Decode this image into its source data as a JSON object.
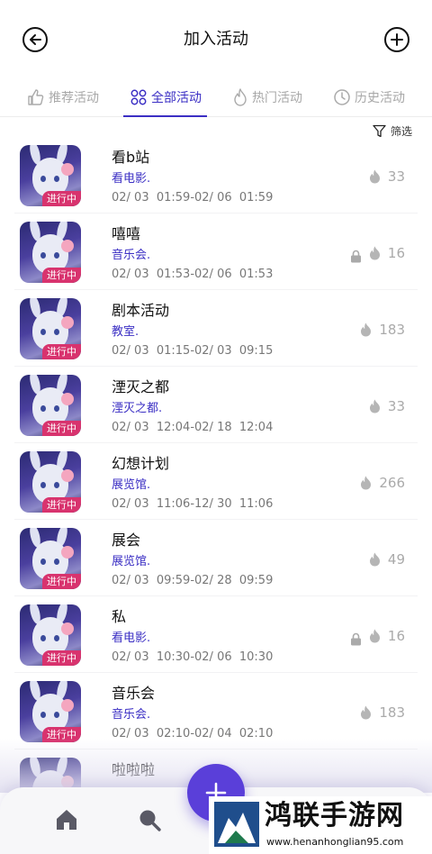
{
  "header": {
    "title": "加入活动",
    "back_icon": "arrow-left-icon",
    "add_icon": "plus-circle-icon"
  },
  "tabs": [
    {
      "label": "推荐活动",
      "icon": "thumbs-up-icon",
      "active": false
    },
    {
      "label": "全部活动",
      "icon": "grid-icon",
      "active": true
    },
    {
      "label": "热门活动",
      "icon": "flame-icon",
      "active": false
    },
    {
      "label": "历史活动",
      "icon": "clock-icon",
      "active": false
    }
  ],
  "filter": {
    "label": "筛选",
    "icon": "funnel-icon"
  },
  "status_badge": "进行中",
  "events": [
    {
      "title": "看b站",
      "category": "看电影.",
      "date": "02/ 03  01:59-02/ 06  01:59",
      "count": "33",
      "locked": false
    },
    {
      "title": "嘻嘻",
      "category": "音乐会.",
      "date": "02/ 03  01:53-02/ 06  01:53",
      "count": "16",
      "locked": true
    },
    {
      "title": "剧本活动",
      "category": "教室.",
      "date": "02/ 03  01:15-02/ 03  09:15",
      "count": "183",
      "locked": false
    },
    {
      "title": "湮灭之都",
      "category": "湮灭之都.",
      "date": "02/ 03  12:04-02/ 18  12:04",
      "count": "33",
      "locked": false
    },
    {
      "title": "幻想计划",
      "category": "展览馆.",
      "date": "02/ 03  11:06-12/ 30  11:06",
      "count": "266",
      "locked": false
    },
    {
      "title": "展会",
      "category": "展览馆.",
      "date": "02/ 03  09:59-02/ 28  09:59",
      "count": "49",
      "locked": false
    },
    {
      "title": "私",
      "category": "看电影.",
      "date": "02/ 03  10:30-02/ 06  10:30",
      "count": "16",
      "locked": true
    },
    {
      "title": "音乐会",
      "category": "音乐会.",
      "date": "02/ 03  02:10-02/ 04  02:10",
      "count": "183",
      "locked": false
    },
    {
      "title": "啦啦啦",
      "category": "",
      "date": "",
      "count": "",
      "locked": false
    }
  ],
  "bottom_nav": [
    {
      "icon": "home-icon"
    },
    {
      "icon": "search-icon"
    }
  ],
  "fab": {
    "icon": "plus-icon"
  },
  "watermark": {
    "title": "鸿联手游网",
    "url": "www.henanhonglian95.com"
  },
  "colors": {
    "accent": "#3b2fc4",
    "badge": "#d8336e",
    "fab": "#5a3fd9",
    "muted": "#aaaaaa"
  }
}
